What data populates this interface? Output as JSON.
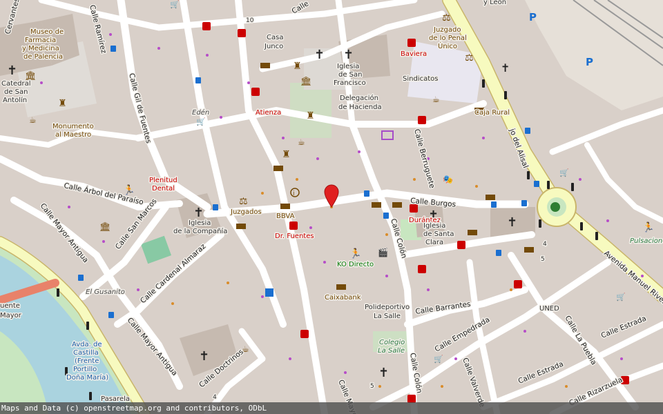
{
  "attribution": "Maps and Data (c) openstreetmap.org and contributors, ODbL",
  "marker": {
    "name": "location-pin",
    "color": "#e02020"
  },
  "labels": {
    "cervantes": "Cervantes",
    "ramirez": "Calle Ramírez",
    "gil_fuentes": "Calle Gil de Fuentes",
    "arbol": "Calle Árbol del Paraíso",
    "mayor_ant_1": "Calle Mayor Antigua",
    "mayor_ant_2": "Calle Mayor Antigua",
    "san_marcos": "Calle San Marcos",
    "cardenal": "Calle Cardenal Almaraz",
    "doctrinos": "Calle Doctrinos",
    "burgos": "Calle Burgos",
    "berruguete": "Calle Berruguete",
    "colon_1": "Calle Colón",
    "colon_2": "Calle Colón",
    "mayor": "Calle Mayor",
    "barrantes": "Calle Barrantes",
    "empedrada": "Calle Empedrada",
    "valverde": "Calle Valverde",
    "estrada_1": "Calle Estrada",
    "estrada_2": "Calle Estrada",
    "la_puebla": "Calle La Puebla",
    "rizarzuela": "Calle Rizarzuela",
    "alisal": "jo del Alisal",
    "manuel_rivera": "Avenida Manuel Rivera",
    "calle_top": "Calle",
    "y_leon": "y León",
    "museo": [
      "Museo de",
      "Farmacia",
      "y Medicina",
      "de Palencia"
    ],
    "catedral": [
      "Catedral",
      "de San",
      "Antolín"
    ],
    "monumento": [
      "Monumento",
      "al Maestro"
    ],
    "casa_junco": [
      "Casa",
      "Junco"
    ],
    "iglesia_sf": [
      "Iglesia",
      "de San",
      "Francisco"
    ],
    "juzgado_pena": [
      "Juzgado",
      "de lo Penal",
      "Único"
    ],
    "baviera": "Baviera",
    "sindicatos": "Sindicatos",
    "delegacion": [
      "Delegación",
      "de Hacienda"
    ],
    "eden": "Edén",
    "atienza": "Atienza",
    "caja_rural": "Caja Rural",
    "plenitud": [
      "Plenitud",
      "Dental"
    ],
    "juzgados": "Juzgados",
    "bbva": "BBVA",
    "dr_fuentes": "Dr. Fuentes",
    "iglesia_comp": [
      "Iglesia",
      "de la Compañía"
    ],
    "durantez": "Durántez",
    "iglesia_sc": [
      "Iglesia",
      "de Santa",
      "Clara"
    ],
    "ko_directo": "KO Directo",
    "caixabank": "Caixabank",
    "polideportivo": [
      "Polideportivo",
      "La Salle"
    ],
    "colegio": [
      "Colegio",
      "La Salle"
    ],
    "uned": "UNED",
    "pulsacione": "Pulsacione",
    "gusanito": "El Gusanito",
    "avda_castilla": [
      "Avda. de",
      "Castilla",
      "(Frente",
      "Portillo",
      "Doña María)"
    ],
    "puente": [
      "uente",
      "Mayor"
    ],
    "pasarela": "Pasarela",
    "num_10": "10",
    "num_4": "4",
    "num_5a": "5",
    "num_5b": "5",
    "num_4b": "4"
  }
}
